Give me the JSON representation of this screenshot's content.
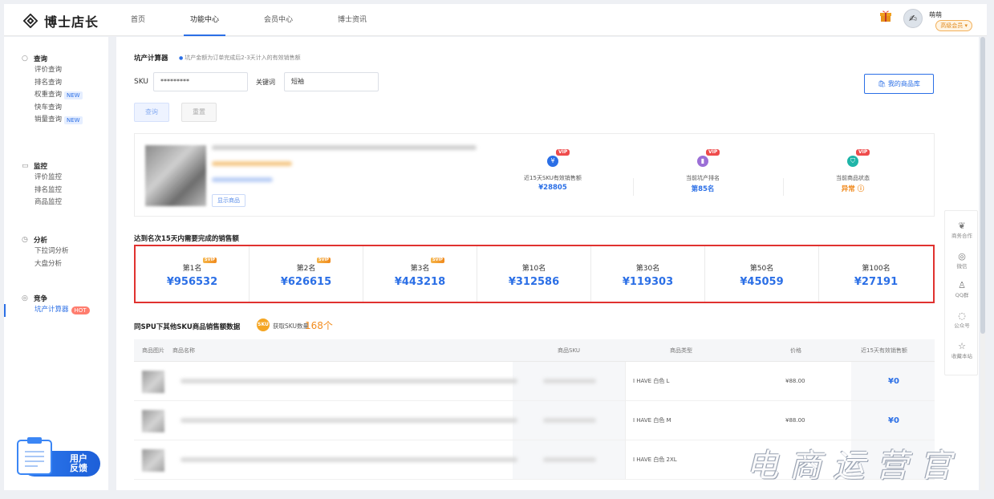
{
  "header": {
    "logo": "博士店长",
    "nav": [
      "首页",
      "功能中心",
      "会员中心",
      "博士资讯"
    ],
    "active_nav": "功能中心",
    "user_name": "萌萌",
    "user_level": "高级会员 ▾"
  },
  "sidebar": {
    "groups": [
      {
        "title": "查询",
        "icon": "search-icon",
        "items": [
          {
            "label": "评价查询",
            "tag": ""
          },
          {
            "label": "排名查询",
            "tag": ""
          },
          {
            "label": "权重查询",
            "tag": "NEW"
          },
          {
            "label": "快车查询",
            "tag": ""
          },
          {
            "label": "销量查询",
            "tag": "NEW"
          }
        ]
      },
      {
        "title": "监控",
        "icon": "monitor-icon",
        "items": [
          {
            "label": "评价监控",
            "tag": ""
          },
          {
            "label": "排名监控",
            "tag": ""
          },
          {
            "label": "商品监控",
            "tag": ""
          }
        ]
      },
      {
        "title": "分析",
        "icon": "clock-icon",
        "items": [
          {
            "label": "下拉词分析",
            "tag": ""
          },
          {
            "label": "大盘分析",
            "tag": ""
          }
        ]
      },
      {
        "title": "竞争",
        "icon": "target-icon",
        "items": [
          {
            "label": "坑产计算器",
            "tag": "HOT",
            "active": true
          }
        ]
      }
    ],
    "feedback_line1": "用户",
    "feedback_line2": "反馈"
  },
  "calculator": {
    "title": "坑产计算器",
    "hint": "坑产金额为订单完成后2-3天计入的有效销售额",
    "sku_label": "SKU",
    "sku_value": "*********",
    "keyword_label": "关键词",
    "keyword_value": "短袖",
    "query_label": "查询",
    "reset_label": "重置",
    "library_label": "我的商品库"
  },
  "product": {
    "show_label": "显示商品",
    "metrics": [
      {
        "label": "近15天SKU有效销售额",
        "value": "¥28805",
        "icon": "yen-icon",
        "color": "#2b6fe6",
        "badge": "VIP"
      },
      {
        "label": "当前坑产排名",
        "value": "第85名",
        "icon": "ranking-icon",
        "color": "#9b6fd6",
        "badge": "VIP"
      },
      {
        "label": "当前商品状态",
        "value": "异常 ⓘ",
        "icon": "shield-icon",
        "color": "#1fb5a8",
        "badge": "VIP"
      }
    ]
  },
  "ranks": {
    "title": "达到名次15天内需要完成的销售额",
    "badge": "SVIP",
    "items": [
      {
        "label": "第1名",
        "value": "¥956532",
        "svip": true
      },
      {
        "label": "第2名",
        "value": "¥626615",
        "svip": true
      },
      {
        "label": "第3名",
        "value": "¥443218",
        "svip": true
      },
      {
        "label": "第10名",
        "value": "¥312586",
        "svip": false
      },
      {
        "label": "第30名",
        "value": "¥119303",
        "svip": false
      },
      {
        "label": "第50名",
        "value": "¥45059",
        "svip": false
      },
      {
        "label": "第100名",
        "value": "¥27191",
        "svip": false
      }
    ]
  },
  "spu": {
    "title": "同SPU下其他SKU商品销售额数据",
    "icon_text": "SKU",
    "count_label": "获取SKU数量",
    "count_value": "168个",
    "columns": [
      "商品图片",
      "商品名称",
      "商品SKU",
      "商品类型",
      "价格",
      "近15天有效销售额"
    ],
    "rows": [
      {
        "type": "I HAVE 白色  L",
        "price": "¥88.00",
        "sales": "¥0"
      },
      {
        "type": "I HAVE 白色  M",
        "price": "¥88.00",
        "sales": "¥0"
      },
      {
        "type": "I HAVE 白色  2XL",
        "price": "",
        "sales": ""
      }
    ]
  },
  "float_bar": [
    {
      "label": "商务合作",
      "icon": "handshake-icon"
    },
    {
      "label": "微信",
      "icon": "wechat-icon"
    },
    {
      "label": "QQ群",
      "icon": "qq-icon"
    },
    {
      "label": "公众号",
      "icon": "chat-icon"
    },
    {
      "label": "收藏本站",
      "icon": "star-icon"
    }
  ],
  "watermark": "电商运营官"
}
